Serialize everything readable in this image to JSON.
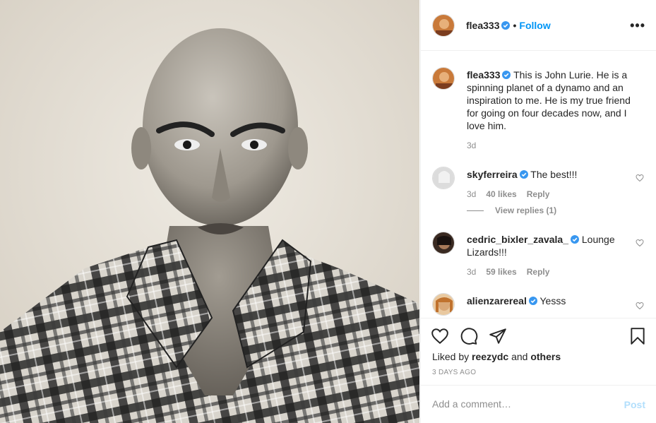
{
  "post": {
    "author": "flea333",
    "follow_label": "Follow",
    "separator": "•",
    "more_label": "•••"
  },
  "caption": {
    "username": "flea333",
    "text": "This is John Lurie. He is a spinning planet of a dynamo and an inspiration to me. He is my true friend for going on four decades now, and I love him.",
    "age": "3d"
  },
  "comments": [
    {
      "username": "skyferreira",
      "text": "The best!!!",
      "age": "3d",
      "likes": "40 likes",
      "reply_label": "Reply",
      "view_replies": "View replies (1)"
    },
    {
      "username": "cedric_bixler_zavala_",
      "text": "Lounge Lizards!!!",
      "age": "3d",
      "likes": "59 likes",
      "reply_label": "Reply"
    },
    {
      "username": "alienzarereal",
      "text": "Yesss"
    }
  ],
  "likes_line": {
    "prefix": "Liked by",
    "user": "reezydc",
    "conj": "and",
    "others": "others"
  },
  "timestamp": "3 DAYS AGO",
  "comment_box": {
    "placeholder": "Add a comment…",
    "post_label": "Post"
  },
  "colors": {
    "accent": "#0095f6",
    "post_disabled": "#b2dffc",
    "muted": "#8e8e8e"
  },
  "icons": [
    "heart-icon",
    "comment-icon",
    "share-icon",
    "bookmark-icon",
    "verified-badge-icon",
    "more-icon"
  ]
}
